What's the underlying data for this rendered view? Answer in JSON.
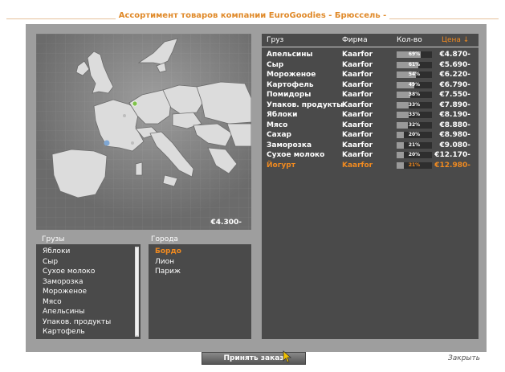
{
  "header": {
    "title": "Ассортимент товаров компании EuroGoodies - Брюссель -"
  },
  "map": {
    "price": "€4.300-"
  },
  "cargo": {
    "label": "Грузы",
    "items": [
      "Яблоки",
      "Сыр",
      "Сухое молоко",
      "Заморозка",
      "Мороженое",
      "Мясо",
      "Апельсины",
      "Упаков. продукты",
      "Картофель"
    ]
  },
  "cities": {
    "label": "Города",
    "items": [
      "Бордо",
      "Лион",
      "Париж"
    ],
    "selected": "Бордо"
  },
  "goods": {
    "columns": {
      "name": "Груз",
      "firm": "Фирма",
      "qty": "Кол-во",
      "price": "Цена ↓"
    },
    "rows": [
      {
        "name": "Апельсины",
        "firm": "Kaarfor",
        "pct": "69%",
        "fill": 0.69,
        "price": "€4.870-"
      },
      {
        "name": "Сыр",
        "firm": "Kaarfor",
        "pct": "61%",
        "fill": 0.61,
        "price": "€5.690-"
      },
      {
        "name": "Мороженое",
        "firm": "Kaarfor",
        "pct": "54%",
        "fill": 0.54,
        "price": "€6.220-"
      },
      {
        "name": "Картофель",
        "firm": "Kaarfor",
        "pct": "49%",
        "fill": 0.49,
        "price": "€6.790-"
      },
      {
        "name": "Помидоры",
        "firm": "Kaarfor",
        "pct": "38%",
        "fill": 0.38,
        "price": "€7.550-"
      },
      {
        "name": "Упаков. продукты",
        "firm": "Kaarfor",
        "pct": "33%",
        "fill": 0.33,
        "price": "€7.890-"
      },
      {
        "name": "Яблоки",
        "firm": "Kaarfor",
        "pct": "33%",
        "fill": 0.33,
        "price": "€8.190-"
      },
      {
        "name": "Мясо",
        "firm": "Kaarfor",
        "pct": "32%",
        "fill": 0.32,
        "price": "€8.880-"
      },
      {
        "name": "Сахар",
        "firm": "Kaarfor",
        "pct": "20%",
        "fill": 0.2,
        "price": "€8.980-"
      },
      {
        "name": "Заморозка",
        "firm": "Kaarfor",
        "pct": "21%",
        "fill": 0.21,
        "price": "€9.080-"
      },
      {
        "name": "Сухое молоко",
        "firm": "Kaarfor",
        "pct": "20%",
        "fill": 0.2,
        "price": "€12.170-"
      },
      {
        "name": "Йогурт",
        "firm": "Kaarfor",
        "pct": "21%",
        "fill": 0.21,
        "price": "€12.980-",
        "selected": true
      }
    ]
  },
  "actions": {
    "accept": "Принять заказ",
    "close": "Закрыть"
  },
  "colors": {
    "accent": "#f08a20",
    "panel": "#4a4a4a",
    "frame": "#9e9e9e"
  }
}
